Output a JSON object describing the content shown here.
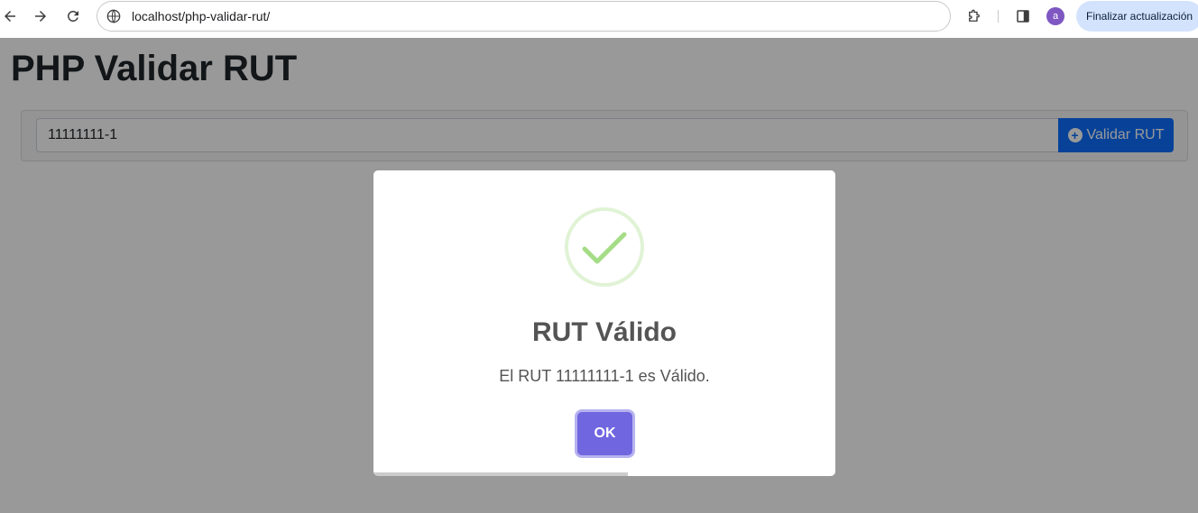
{
  "browser": {
    "url": "localhost/php-validar-rut/",
    "profile_initial": "a",
    "update_label": "Finalizar actualización"
  },
  "page": {
    "title": "PHP Validar RUT",
    "input_value": "11111111-1",
    "validate_label": "Validar RUT"
  },
  "modal": {
    "title": "RUT Válido",
    "text": "El RUT 11111111-1 es Válido.",
    "ok_label": "OK",
    "timer_progress": 0.55
  },
  "colors": {
    "primary": "#0d6efd",
    "confirm": "#7066e0",
    "success": "#a5dc86"
  }
}
